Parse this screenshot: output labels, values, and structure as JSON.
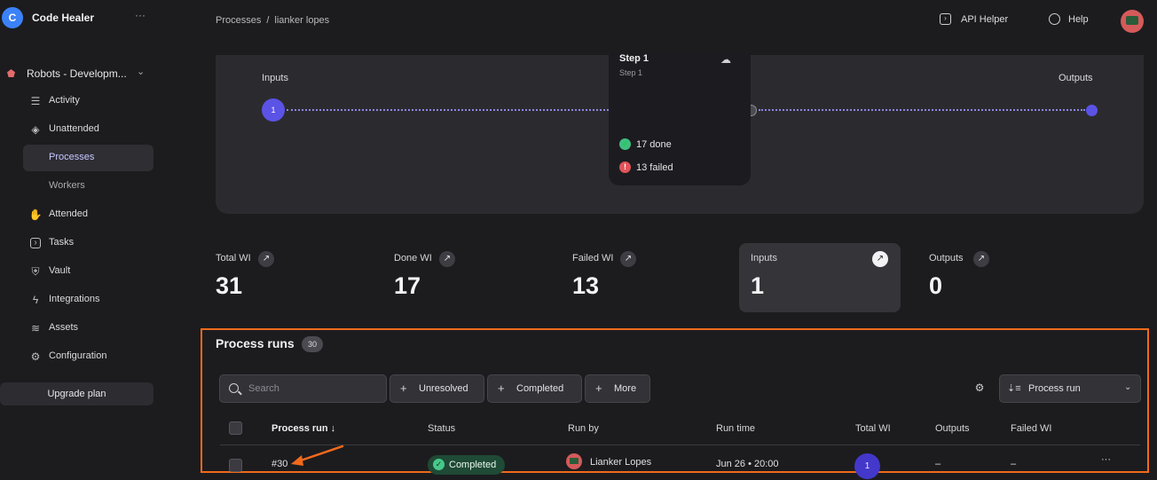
{
  "app": {
    "logo_letter": "C",
    "name": "Code Healer",
    "more": "···"
  },
  "workspace": {
    "label": "Robots - Developm...",
    "chevron": "⌄"
  },
  "nav": [
    {
      "label": "Activity",
      "icon": "list-icon",
      "glyph": "☰"
    },
    {
      "label": "Unattended",
      "icon": "layers-icon",
      "glyph": "◈"
    },
    {
      "label": "Processes",
      "icon": "",
      "glyph": ""
    },
    {
      "label": "Workers",
      "icon": "",
      "glyph": ""
    },
    {
      "label": "Attended",
      "icon": "hand-icon",
      "glyph": "✋"
    },
    {
      "label": "Tasks",
      "icon": "terminal-icon",
      "glyph": "›"
    },
    {
      "label": "Vault",
      "icon": "shield-icon",
      "glyph": "⛨"
    },
    {
      "label": "Integrations",
      "icon": "bolt-icon",
      "glyph": "ϟ"
    },
    {
      "label": "Assets",
      "icon": "database-icon",
      "glyph": "≋"
    },
    {
      "label": "Configuration",
      "icon": "sliders-icon",
      "glyph": "⚙"
    }
  ],
  "upgrade_label": "Upgrade plan",
  "breadcrumb": {
    "first": "Processes",
    "sep": "/",
    "current": "lianker lopes"
  },
  "header": {
    "api_helper": "API Helper",
    "help": "Help"
  },
  "flow": {
    "inputs_label": "Inputs",
    "outputs_label": "Outputs",
    "input_node": "1",
    "step": {
      "title": "Step 1",
      "subtitle": "Step 1",
      "done": "17 done",
      "failed": "13 failed"
    }
  },
  "stats": [
    {
      "label": "Total WI",
      "value": "31"
    },
    {
      "label": "Done WI",
      "value": "17"
    },
    {
      "label": "Failed WI",
      "value": "13"
    },
    {
      "label": "Inputs",
      "value": "1"
    },
    {
      "label": "Outputs",
      "value": "0"
    }
  ],
  "runs": {
    "title": "Process runs",
    "count": "30",
    "search_placeholder": "Search",
    "filters": [
      "Unresolved",
      "Completed",
      "More"
    ],
    "sort_label": "Process run",
    "columns": [
      "Process run ↓",
      "Status",
      "Run by",
      "Run time",
      "Total WI",
      "Outputs",
      "Failed WI"
    ],
    "rows": [
      {
        "run": "#30",
        "status": "Completed",
        "run_by": "Lianker Lopes",
        "run_time": "Jun 26 • 20:00",
        "total_wi": "1",
        "outputs": "–",
        "failed_wi": "–",
        "more": "···"
      }
    ]
  },
  "colors": {
    "accent": "#5b53e6",
    "highlight": "#f26a1b",
    "success": "#47c98a",
    "danger": "#e0545a"
  }
}
